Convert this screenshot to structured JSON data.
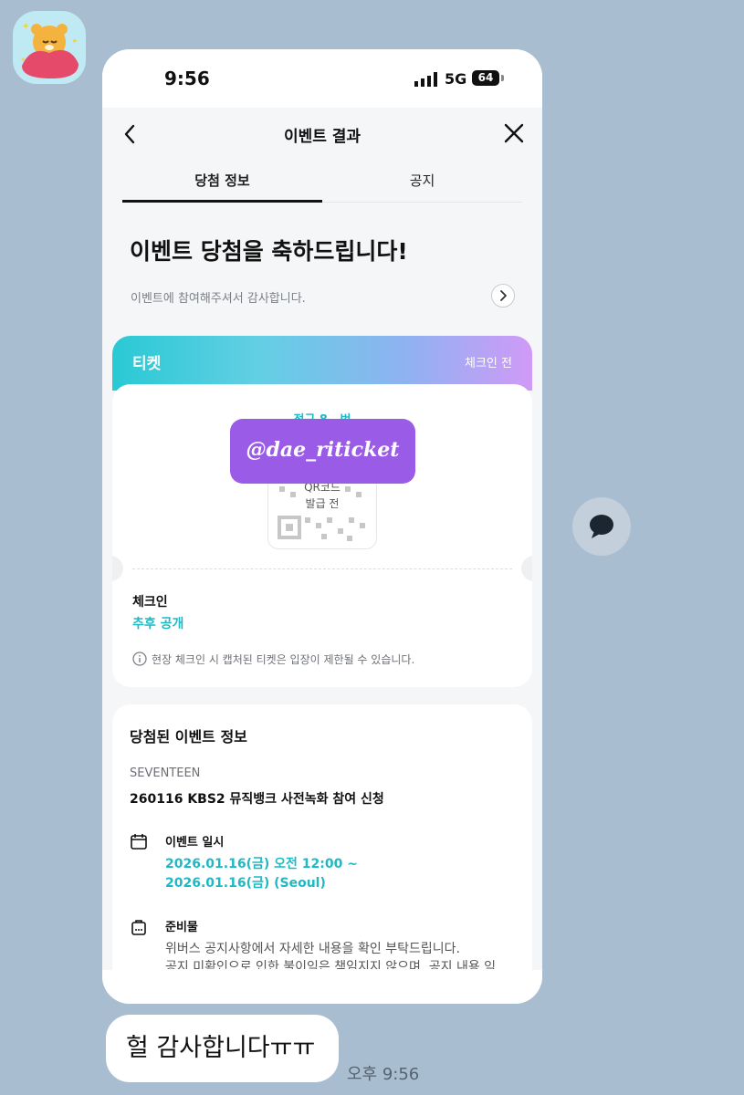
{
  "chat": {
    "bubble_text": "헐 감사합니다ㅠㅠ",
    "timestamp": "오후 9:56",
    "avatar_icon": "bear-sleeping-sticker-icon",
    "reply_icon": "speech-bubble-icon"
  },
  "phone": {
    "status": {
      "time": "9:56",
      "network": "5G",
      "battery": "64"
    },
    "nav": {
      "title": "이벤트 결과",
      "back_icon": "chevron-left-icon",
      "close_icon": "close-icon"
    },
    "tabs": [
      {
        "label": "당첨 정보",
        "active": true
      },
      {
        "label": "공지",
        "active": false
      }
    ],
    "hero": {
      "headline": "이벤트 당첨을 축하드립니다!",
      "subline": "이벤트에 참여해주셔서 감사합니다."
    },
    "ticket": {
      "title": "티켓",
      "status": "체크인 전",
      "seat": "정규 8   번",
      "qr_text_line1": "QR코드",
      "qr_text_line2": "발급 전",
      "watermark": "@dae_riticket",
      "checkin_label": "체크인",
      "checkin_value": "추후 공개",
      "notice": "현장 체크인 시 캡처된 티켓은 입장이 제한될 수 있습니다."
    },
    "event_info": {
      "title": "당첨된 이벤트 정보",
      "artist": "SEVENTEEN",
      "name": "260116 KBS2 뮤직뱅크 사전녹화 참여 신청",
      "date_label": "이벤트 일시",
      "date_line1": "2026.01.16(금) 오전 12:00 ~",
      "date_line2": "2026.01.16(금) (Seoul)",
      "prep_label": "준비물",
      "prep_line1": "위버스 공지사항에서 자세한 내용을 확인 부탁드립니다.",
      "prep_line2": "공지 미확인으로 인한 불이익은 책임지지 않으며, 공지 내용 익"
    },
    "colors": {
      "accent": "#1fb8c3",
      "watermark": "#9a5be6",
      "chat_bg": "#a9bdd1"
    }
  }
}
